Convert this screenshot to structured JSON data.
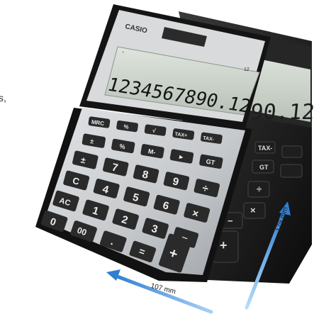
{
  "page": {
    "partial_text": "s,",
    "colors": {
      "background": "#ffffff",
      "front_body": "#c9ccd0",
      "rear_body": "#1a1a1a",
      "lcd": "#c7cfc6",
      "arrow": "#3c8fdb"
    }
  },
  "calculator_front": {
    "brand": "CASIO",
    "display_value": "1234567890.12",
    "display_indicator_left": "-",
    "display_model_tag": "12",
    "icon": "calculator-icon",
    "keys": {
      "row1": [
        "MRC",
        "%",
        "√",
        "TAX+",
        "TAX-"
      ],
      "row2": [
        "±",
        "%",
        "M-",
        "►",
        "GT"
      ],
      "row3": [
        "±",
        "7",
        "8",
        "9",
        "÷"
      ],
      "row4": [
        "C",
        "4",
        "5",
        "6",
        "×"
      ],
      "row5": [
        "AC",
        "1",
        "2",
        "3",
        "−"
      ],
      "row6": [
        "0",
        "00",
        ".",
        "=",
        "+"
      ]
    }
  },
  "calculator_rear": {
    "display_value": "890.12",
    "visible_keys": [
      "TAX-",
      "GT",
      "÷",
      "×",
      "−",
      "+"
    ]
  },
  "dimensions": {
    "width_label": "107 mm",
    "height_label": "179 mm",
    "arrow_icon": "arrow-icon"
  }
}
